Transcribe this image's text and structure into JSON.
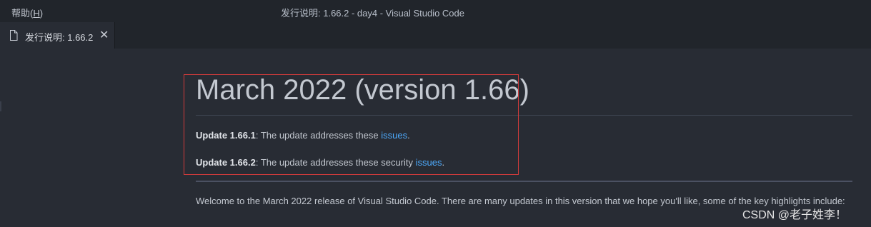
{
  "titlebar": {
    "menu_help": "帮助",
    "menu_help_mnemonic": "H",
    "window_title": "发行说明: 1.66.2 - day4 - Visual Studio Code"
  },
  "tabs": [
    {
      "label": "发行说明: 1.66.2",
      "icon": "file-icon",
      "close_glyph": "✕"
    }
  ],
  "content": {
    "title": "March 2022 (version 1.66)",
    "update1": {
      "prefix": "Update 1.66.1",
      "text": ": The update addresses these ",
      "link": "issues",
      "suffix": "."
    },
    "update2": {
      "prefix": "Update 1.66.2",
      "text": ": The update addresses these security ",
      "link": "issues",
      "suffix": "."
    },
    "welcome": "Welcome to the March 2022 release of Visual Studio Code. There are many updates in this version that we hope you'll like, some of the key highlights include:"
  },
  "watermark": "CSDN @老子姓李！",
  "colors": {
    "editor_bg": "#282c34",
    "titlebar_bg": "#21252b",
    "link": "#4daafc",
    "highlight_border": "#d23b3b"
  }
}
